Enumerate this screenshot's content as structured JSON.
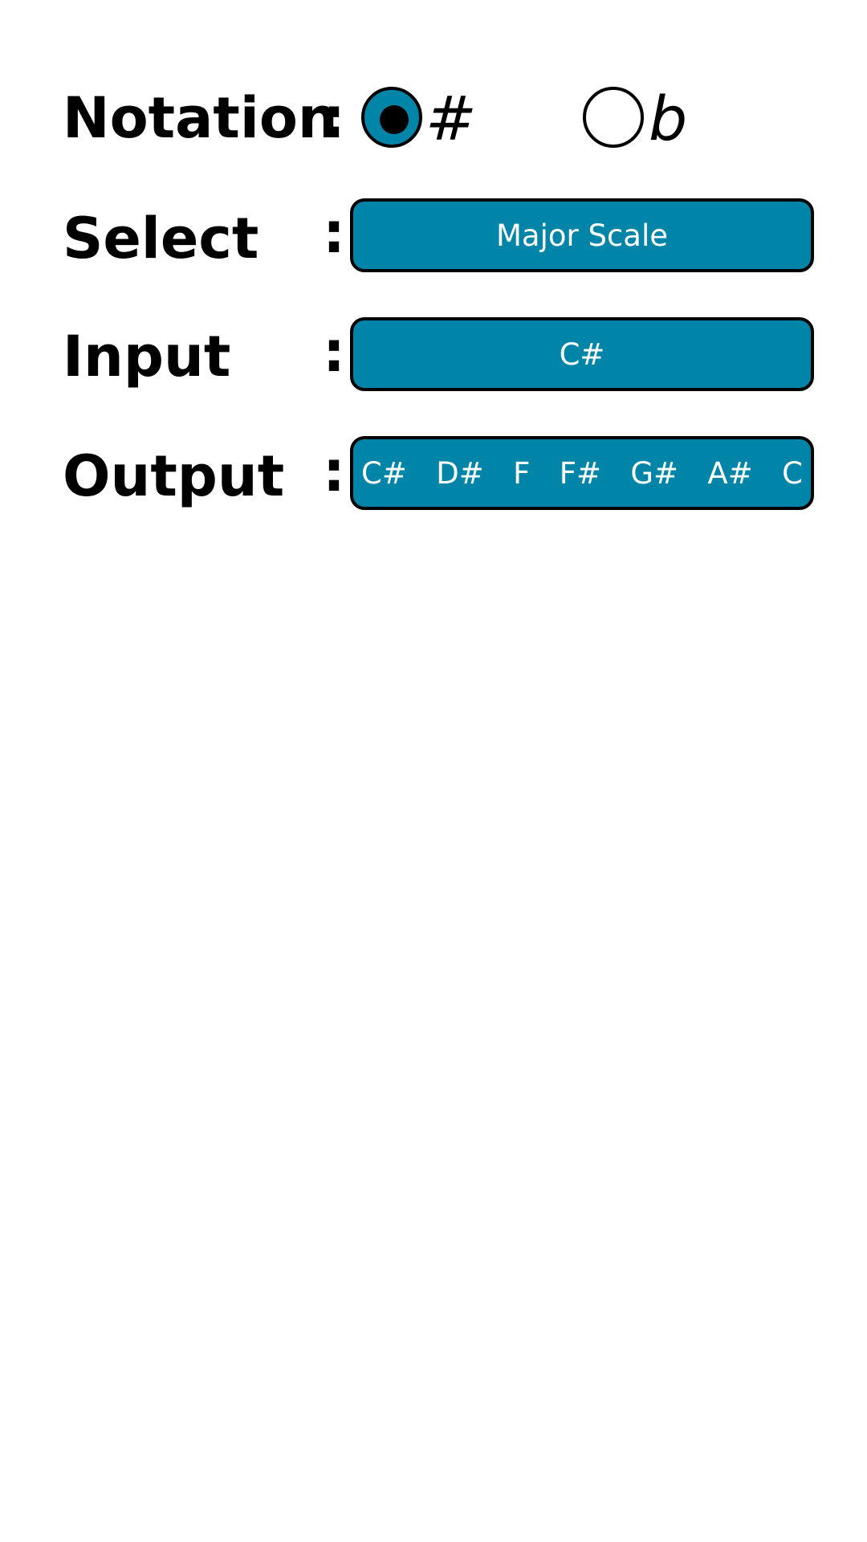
{
  "notation": {
    "label": "Notation",
    "colon": ":",
    "options": [
      {
        "symbol": "#",
        "selected": true
      },
      {
        "symbol": "b",
        "selected": false
      }
    ]
  },
  "select": {
    "label": "Select",
    "colon": ":",
    "value": "Major Scale"
  },
  "input": {
    "label": "Input",
    "colon": ":",
    "value": "C#"
  },
  "output": {
    "label": "Output",
    "colon": ":",
    "notes": [
      "C#",
      "D#",
      "F",
      "F#",
      "G#",
      "A#",
      "C"
    ]
  },
  "colors": {
    "accent": "#0085a8",
    "border": "#000000",
    "background": "#ffffff",
    "field_text": "#ffffff"
  }
}
